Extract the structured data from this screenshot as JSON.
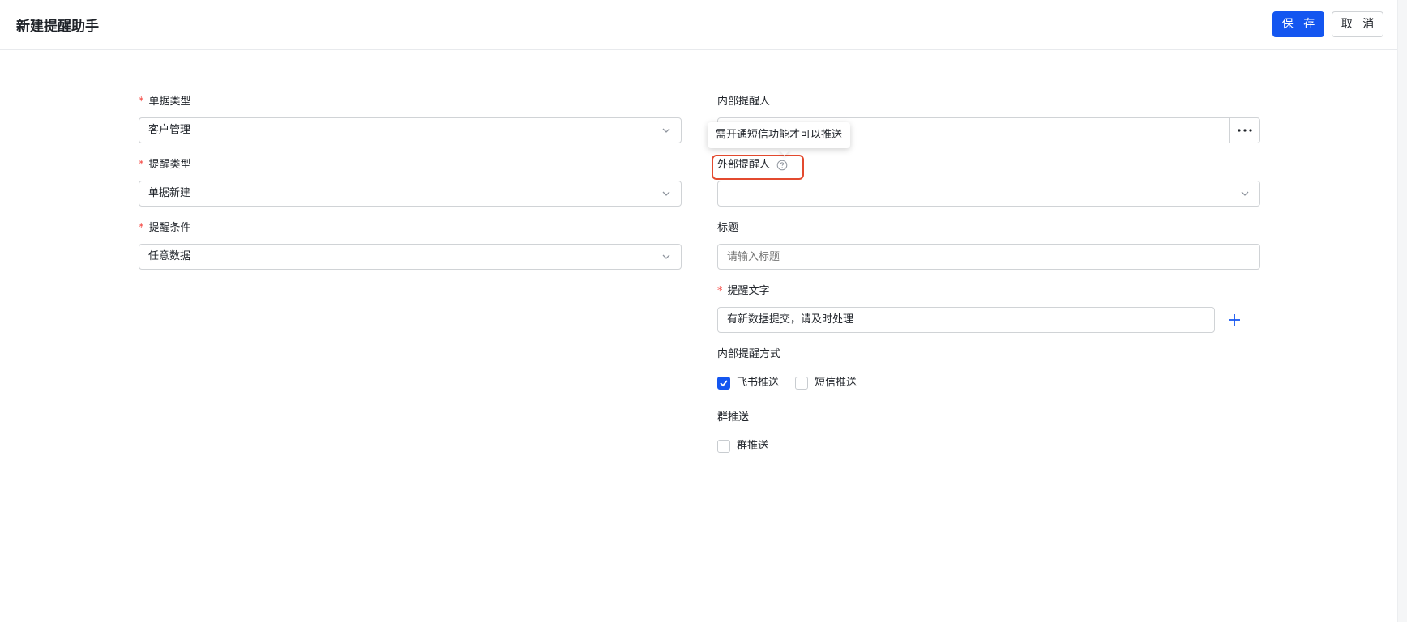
{
  "header": {
    "title": "新建提醒助手",
    "save_label": "保 存",
    "cancel_label": "取 消"
  },
  "colors": {
    "primary": "#1456f0",
    "required": "#f54a45",
    "highlight": "#e34a2f"
  },
  "form": {
    "doc_type": {
      "label": "单据类型",
      "required": "*",
      "value": "客户管理"
    },
    "remind_type": {
      "label": "提醒类型",
      "required": "*",
      "value": "单据新建"
    },
    "remind_condition": {
      "label": "提醒条件",
      "required": "*",
      "value": "任意数据"
    },
    "internal_reminder": {
      "label": "内部提醒人",
      "value": ""
    },
    "external_reminder": {
      "label": "外部提醒人",
      "value": "",
      "help_tooltip": "需开通短信功能才可以推送"
    },
    "title": {
      "label": "标题",
      "placeholder": "请输入标题",
      "value": ""
    },
    "remind_text": {
      "label": "提醒文字",
      "required": "*",
      "value": "有新数据提交，请及时处理"
    },
    "internal_method": {
      "label": "内部提醒方式",
      "options": [
        {
          "label": "飞书推送",
          "checked": true
        },
        {
          "label": "短信推送",
          "checked": false
        }
      ]
    },
    "group_push": {
      "label": "群推送",
      "options": [
        {
          "label": "群推送",
          "checked": false
        }
      ]
    }
  }
}
